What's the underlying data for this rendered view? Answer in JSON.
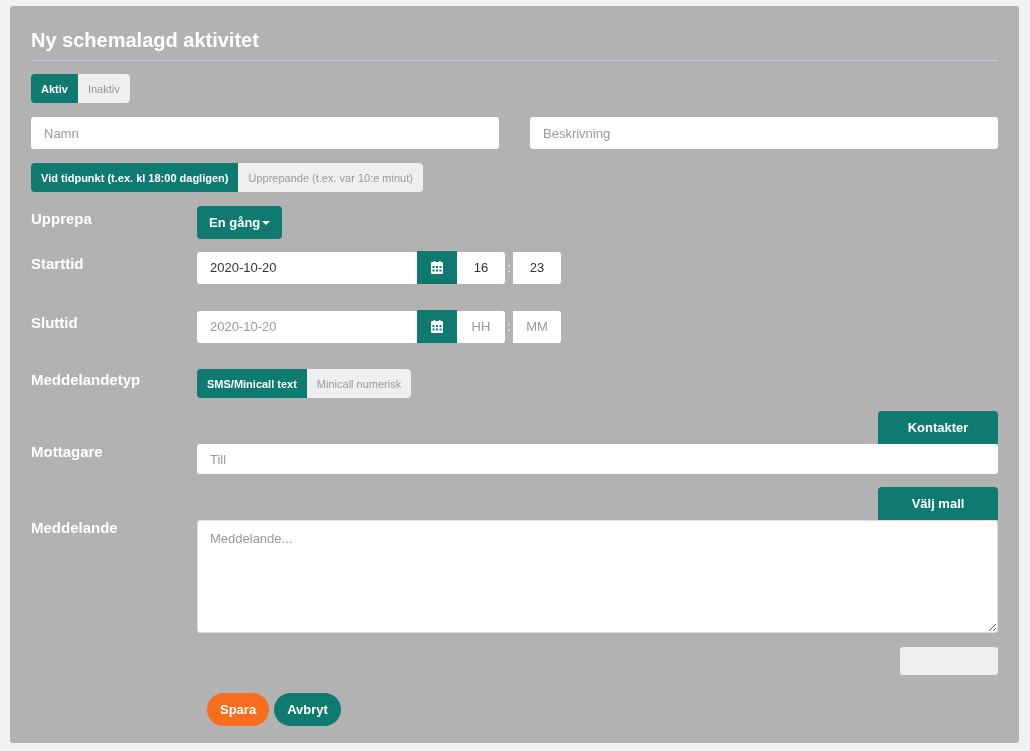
{
  "title": "Ny schemalagd aktivitet",
  "status_options": [
    {
      "label": "Aktiv",
      "selected": true
    },
    {
      "label": "Inaktiv",
      "selected": false
    }
  ],
  "name_field": {
    "placeholder": "Namn"
  },
  "description_field": {
    "placeholder": "Beskrivning"
  },
  "schedule_modes": [
    {
      "label": "Vid tidpunkt (t.ex. kl 18:00 dagligen)",
      "selected": true
    },
    {
      "label": "Upprepande (t.ex. var 10:e minut)",
      "selected": false
    }
  ],
  "repeat": {
    "label": "Upprepa",
    "value": "En gång"
  },
  "times": [
    {
      "label": "Starttid",
      "date": {
        "value": "2020-10-20"
      },
      "hour": {
        "value": "16"
      },
      "separator": ":",
      "minute": {
        "value": "23"
      }
    },
    {
      "label": "Sluttid",
      "date": {
        "placeholder": "2020-10-20"
      },
      "hour": {
        "placeholder": "HH"
      },
      "separator": ":",
      "minute": {
        "placeholder": "MM"
      }
    }
  ],
  "message_type": {
    "label": "Meddelandetyp",
    "options": [
      {
        "label": "SMS/Minicall text",
        "selected": true
      },
      {
        "label": "Minicall numerisk",
        "selected": false
      }
    ]
  },
  "recipients": {
    "label": "Mottagare",
    "button": "Kontakter",
    "placeholder": "Till"
  },
  "message": {
    "label": "Meddelande",
    "button": "Välj mall",
    "placeholder": "Meddelande..."
  },
  "actions": [
    {
      "label": "Spara",
      "kind": "primary"
    },
    {
      "label": "Avbryt",
      "kind": "secondary"
    }
  ]
}
